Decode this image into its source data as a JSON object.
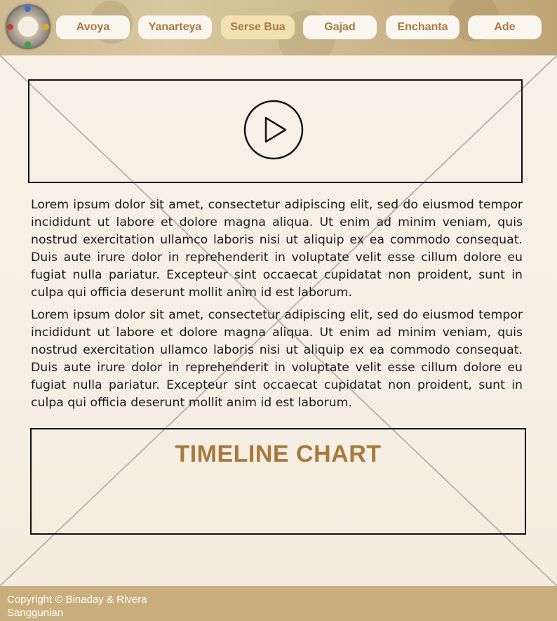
{
  "nav": {
    "items": [
      {
        "label": "Avoya"
      },
      {
        "label": "Yanarteya"
      },
      {
        "label": "Serse Bua",
        "active": true
      },
      {
        "label": "Gajad"
      },
      {
        "label": "Enchanta"
      },
      {
        "label": "Ade"
      }
    ]
  },
  "main": {
    "video_icon": "play-icon",
    "paragraphs": [
      "Lorem ipsum dolor sit amet, consectetur adipiscing elit, sed do eiusmod tempor incididunt ut labore et dolore magna aliqua. Ut enim ad minim veniam, quis nostrud exercitation ullamco laboris nisi ut aliquip ex ea commodo consequat. Duis aute irure dolor in reprehenderit in voluptate velit esse cillum dolore eu fugiat nulla pariatur. Excepteur sint occaecat cupidatat non proident, sunt in culpa qui officia deserunt mollit anim id est laborum.",
      "Lorem ipsum dolor sit amet, consectetur adipiscing elit, sed do eiusmod tempor incididunt ut labore et dolore magna aliqua. Ut enim ad minim veniam, quis nostrud exercitation ullamco laboris nisi ut aliquip ex ea commodo consequat. Duis aute irure dolor in reprehenderit in voluptate velit esse cillum dolore eu fugiat nulla pariatur. Excepteur sint occaecat cupidatat non proident, sunt in culpa qui officia deserunt mollit anim id est laborum."
    ],
    "timeline_title": "TIMELINE CHART"
  },
  "footer": {
    "copyright": "Copyright © Binaday & Rivera Sanggunian"
  },
  "colors": {
    "accent": "#a8793e",
    "footer_bg": "#c9ae7c",
    "nav_active_bg": "#f3e1b4"
  }
}
